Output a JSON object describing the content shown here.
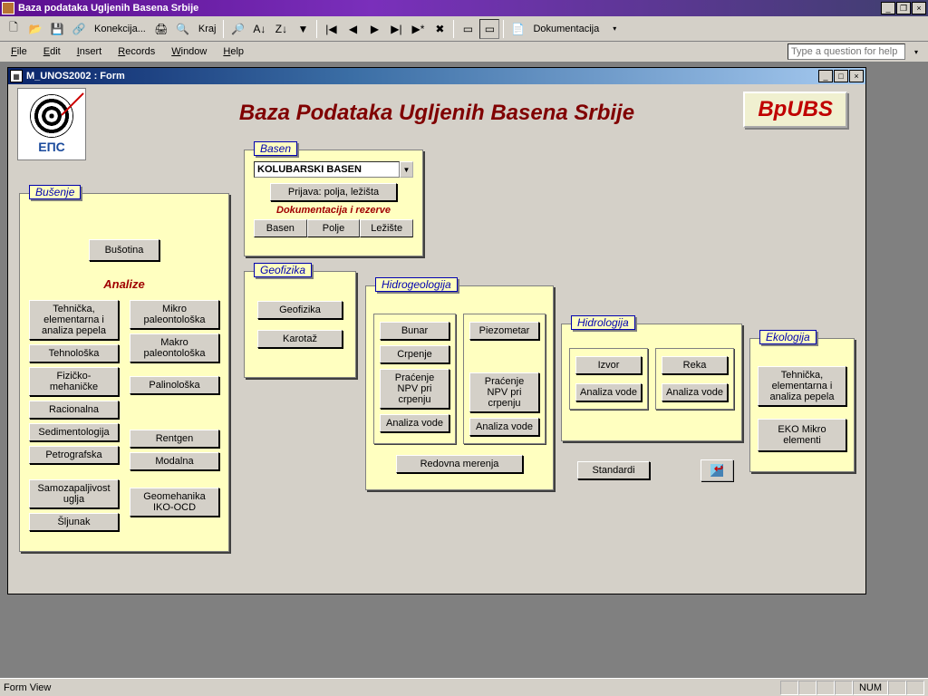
{
  "app": {
    "title": "Baza podataka Ugljenih Basena Srbije"
  },
  "toolbar": {
    "konekcija": "Konekcija...",
    "kraj": "Kraj",
    "dokumentacija": "Dokumentacija"
  },
  "menu": {
    "file": "File",
    "edit": "Edit",
    "insert": "Insert",
    "records": "Records",
    "window": "Window",
    "help": "Help",
    "help_placeholder": "Type a question for help"
  },
  "form": {
    "window_title": "M_UNOS2002 : Form",
    "main_title": "Baza Podataka Ugljenih Basena Srbije",
    "brand": "BpUBS",
    "logo_text": "ЕПС"
  },
  "panels": {
    "busenje": {
      "label": "Bušenje",
      "busotina": "Bušotina",
      "analize_label": "Analize",
      "left": [
        "Tehnička, elementarna i analiza pepela",
        "Tehnološka",
        "Fizičko-mehaničke",
        "Racionalna",
        "Sedimentologija",
        "Petrografska",
        "Samozapaljivost uglja",
        "Šljunak"
      ],
      "right": [
        "Mikro paleontološka",
        "Makro paleontološka",
        "Palinološka",
        "Rentgen",
        "Modalna",
        "Geomehanika IKO-OCD"
      ]
    },
    "basen": {
      "label": "Basen",
      "selected": "KOLUBARSKI BASEN",
      "prijava": "Prijava: polja, ležišta",
      "doc_label": "Dokumentacija i rezerve",
      "btns": [
        "Basen",
        "Polje",
        "Ležište"
      ]
    },
    "geofizika": {
      "label": "Geofizika",
      "btns": [
        "Geofizika",
        "Karotaž"
      ]
    },
    "hidrogeologija": {
      "label": "Hidrogeologija",
      "col1": [
        "Bunar",
        "Crpenje",
        "Praćenje NPV pri crpenju",
        "Analiza vode"
      ],
      "col2": [
        "Piezometar",
        "Praćenje NPV pri crpenju",
        "Analiza vode"
      ],
      "redovna": "Redovna merenja"
    },
    "hidrologija": {
      "label": "Hidrologija",
      "col1": [
        "Izvor",
        "Analiza vode"
      ],
      "col2": [
        "Reka",
        "Analiza vode"
      ],
      "standardi": "Standardi"
    },
    "ekologija": {
      "label": "Ekologija",
      "btns": [
        "Tehnička, elementarna i analiza pepela",
        "EKO Mikro elementi"
      ]
    }
  },
  "statusbar": {
    "left": "Form View",
    "num": "NUM"
  }
}
